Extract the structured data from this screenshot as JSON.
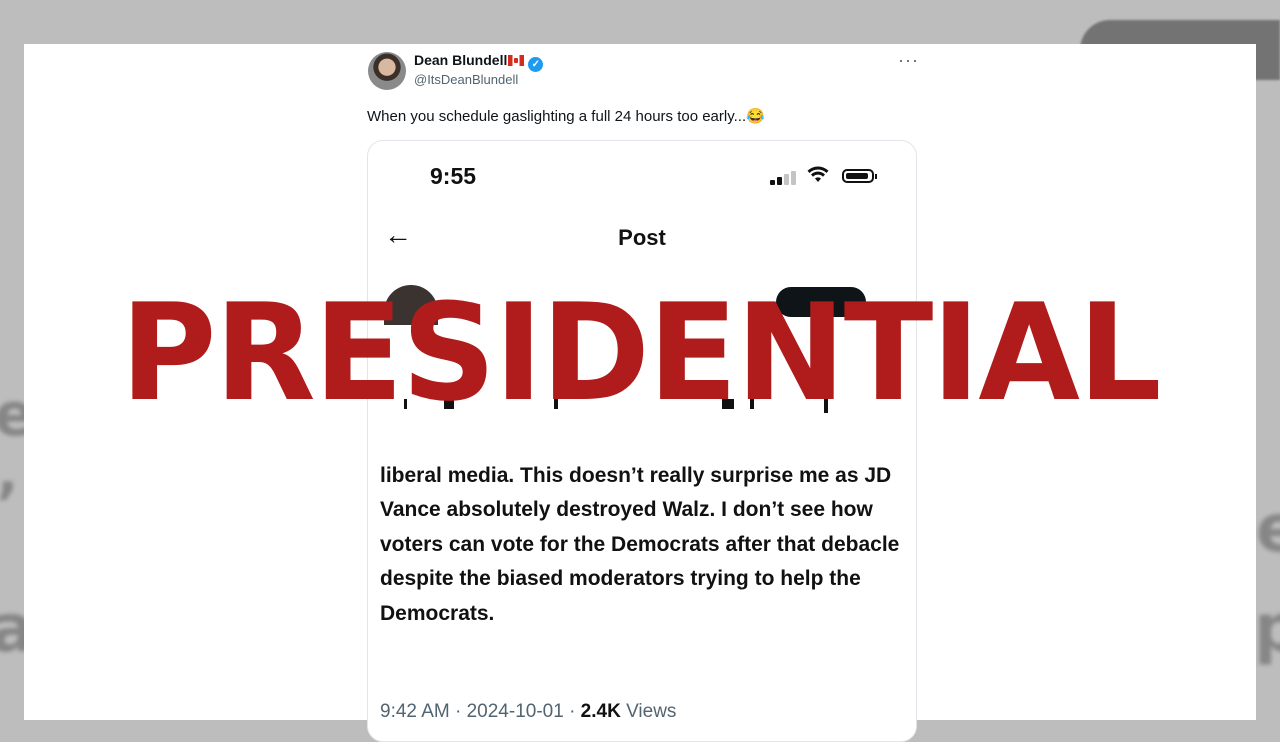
{
  "background": {
    "left_glyphs": [
      "e",
      "’",
      "al"
    ],
    "right_glyphs": [
      "e",
      "p"
    ]
  },
  "tweet": {
    "author_name": "Dean Blundell",
    "handle": "@ItsDeanBlundell",
    "more_label": "···",
    "text": "When you schedule gaslighting a full 24 hours too early...😂",
    "verified_icon": "check-badge-icon"
  },
  "screenshot": {
    "status_time": "9:55",
    "nav_title": "Post",
    "back_icon": "←",
    "body_text": "liberal media. This doesn’t really surprise me as JD Vance absolutely destroyed Walz. I don’t see how voters can vote for the Democrats after that debacle despite the biased moderators trying to help the Democrats.",
    "meta_time": "9:42 AM · 2024-10-01 · ",
    "meta_views_count": "2.4K",
    "meta_views_label": " Views"
  },
  "overlay": {
    "text": "PRESIDENTIAL",
    "color": "#b01c1c"
  },
  "colors": {
    "verified": "#1d9bf0",
    "secondary_text": "#536471",
    "accent_red": "#b01c1c"
  }
}
